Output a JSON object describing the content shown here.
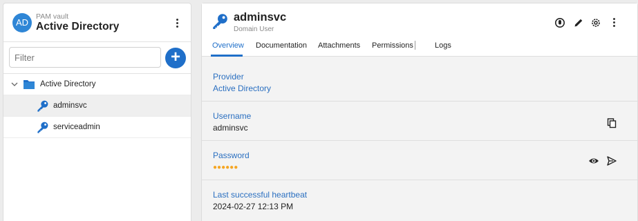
{
  "sidebar": {
    "avatar_initials": "AD",
    "vault_label": "PAM vault",
    "vault_title": "Active Directory",
    "filter_placeholder": "Filter",
    "add_label": "+",
    "tree": [
      {
        "label": "Active Directory",
        "icon": "folder-icon",
        "level": 0
      },
      {
        "label": "adminsvc",
        "icon": "key-icon",
        "level": 1,
        "selected": true
      },
      {
        "label": "serviceadmin",
        "icon": "key-icon",
        "level": 1
      }
    ]
  },
  "entry": {
    "title": "adminsvc",
    "subtitle": "Domain User",
    "tabs": [
      {
        "label": "Overview",
        "active": true
      },
      {
        "label": "Documentation"
      },
      {
        "label": "Attachments"
      },
      {
        "label": "Permissions"
      },
      {
        "label": "Logs"
      }
    ],
    "fields": [
      {
        "label": "Provider",
        "value": "Active Directory"
      },
      {
        "label": "Username",
        "value": "adminsvc"
      },
      {
        "label": "Password",
        "value": "●●●●●●"
      },
      {
        "label": "Last successful heartbeat",
        "value": "2024-02-27 12:13 PM"
      }
    ]
  },
  "icons": {
    "header": [
      "checkout-icon",
      "edit-icon",
      "settings-icon",
      "more-icon"
    ],
    "username": "copy-icon",
    "password": [
      "view-icon",
      "send-icon"
    ]
  },
  "colors": {
    "accent": "#1f6fc9",
    "avatar": "#2f86d6",
    "password_dots": "#f5a623",
    "label": "#2a6fc0"
  }
}
